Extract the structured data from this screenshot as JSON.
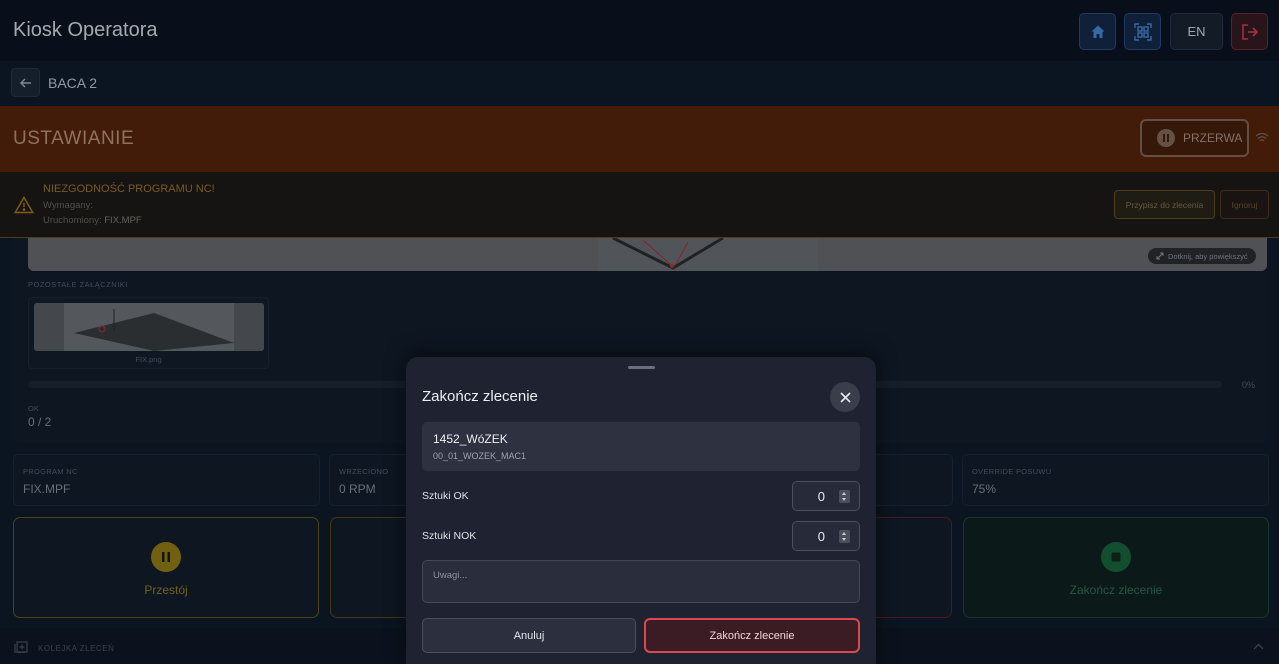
{
  "header": {
    "app_title": "Kiosk Operatora",
    "language": "EN",
    "icons": [
      "home-icon",
      "qr-scan-icon",
      "logout-icon"
    ],
    "accent_color": "#2a4f86"
  },
  "subheader": {
    "machine": "BACA 2"
  },
  "status": {
    "title": "USTAWIANIE",
    "pause_label": "PRZERWA",
    "color": "#5a2509"
  },
  "warning": {
    "title": "NIEZGODNOŚĆ PROGRAMU NC!",
    "required_label": "Wymagany:",
    "running_label": "Uruchomiony:",
    "running_value": "FIX.MPF",
    "assign_label": "Przypisz do zlecenia",
    "ignore_label": "Ignoruj"
  },
  "content": {
    "zoom_hint": "Dotknij, aby powiększyć",
    "attachments_label": "POZOSTAŁE ZAŁĄCZNIKI",
    "attachment_name": "FIX.png",
    "progress_percent": "0%",
    "progress_value": 0,
    "ok_label": "OK",
    "ok_value": "0 / 2"
  },
  "stats": [
    {
      "label": "PROGRAM NC",
      "value": "FIX.MPF"
    },
    {
      "label": "WRZECIONO",
      "value": "0 RPM"
    },
    {
      "label": "OVERRIDE POSUWU",
      "value": "75%"
    }
  ],
  "actions": {
    "downtime_label": "Przestój",
    "finish_label": "Zakończ zlecenie"
  },
  "bottombar": {
    "queue_label": "KOLEJKA ZLECEŃ"
  },
  "modal": {
    "title": "Zakończ zlecenie",
    "order_number": "1452_WóZEK",
    "program": "00_01_WOZEK_MAC1",
    "ok_label": "Sztuki OK",
    "ok_value": "0",
    "nok_label": "Sztuki NOK",
    "nok_value": "0",
    "notes_placeholder": "Uwagi...",
    "cancel_label": "Anuluj",
    "confirm_label": "Zakończ zlecenie"
  }
}
